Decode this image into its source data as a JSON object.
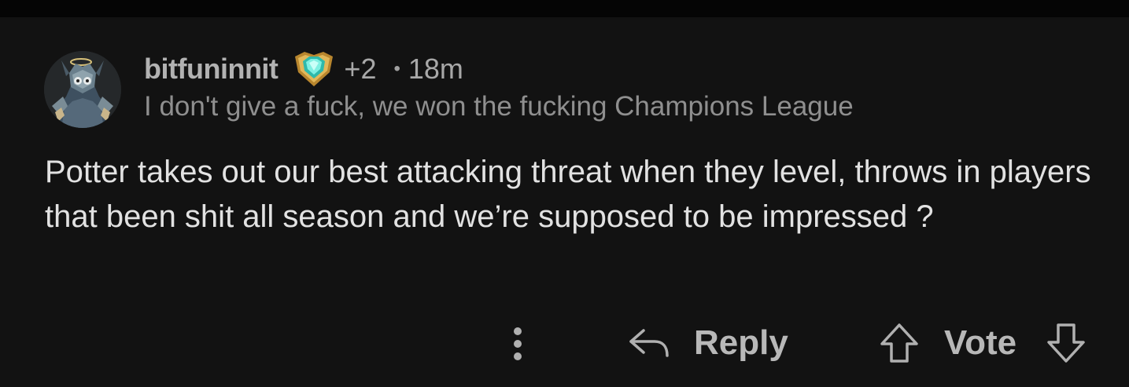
{
  "comment": {
    "username": "bitfuninnit",
    "karma_badge": "+2",
    "separator": "•",
    "age": "18m",
    "user_flair": "I don't give a fuck, we won the fucking Champions League",
    "body": "Potter takes out our best attacking threat when they level, throws in players that been shit all season and we’re supposed to be impressed ?",
    "avatar_icon": "armored-character-avatar",
    "award_icon": "diamond-shield-award-icon"
  },
  "actions": {
    "more_icon": "vertical-dots-icon",
    "reply_icon": "reply-arrow-icon",
    "reply_label": "Reply",
    "upvote_icon": "arrow-up-icon",
    "vote_label": "Vote",
    "downvote_icon": "arrow-down-icon"
  },
  "colors": {
    "background": "#121212",
    "top_bar": "#050505",
    "body_text": "#e2e2e2",
    "meta_text": "#a4a4a4",
    "flair_text": "#8f8f8f",
    "award_gold": "#c9a040",
    "award_gem": "#4fd6c8"
  }
}
